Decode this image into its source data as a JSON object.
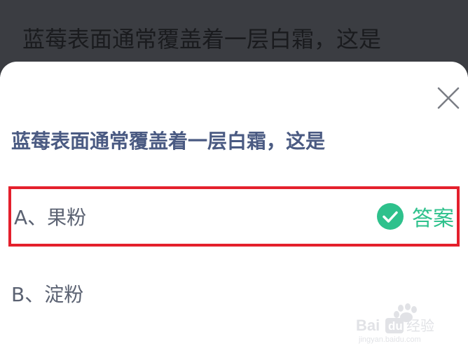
{
  "backdrop": {
    "title": "蓝莓表面通常覆盖着一层白霜，这是"
  },
  "quiz": {
    "question": "蓝莓表面通常覆盖着一层白霜，这是",
    "close_icon": "close-icon",
    "options": [
      {
        "label": "A、果粉",
        "is_answer": true,
        "answer_label": "答案",
        "answer_icon": "check-circle-icon"
      },
      {
        "label": "B、淀粉",
        "is_answer": false
      }
    ]
  },
  "watermark": {
    "brand": "Bai",
    "brand2": "经验",
    "url": "jingyan.baidu.com"
  },
  "colors": {
    "question": "#4a5a82",
    "option_text": "#5b6272",
    "answer_green": "#2ec18c",
    "highlight_red": "#e4202c",
    "backdrop": "#3b3d42"
  }
}
